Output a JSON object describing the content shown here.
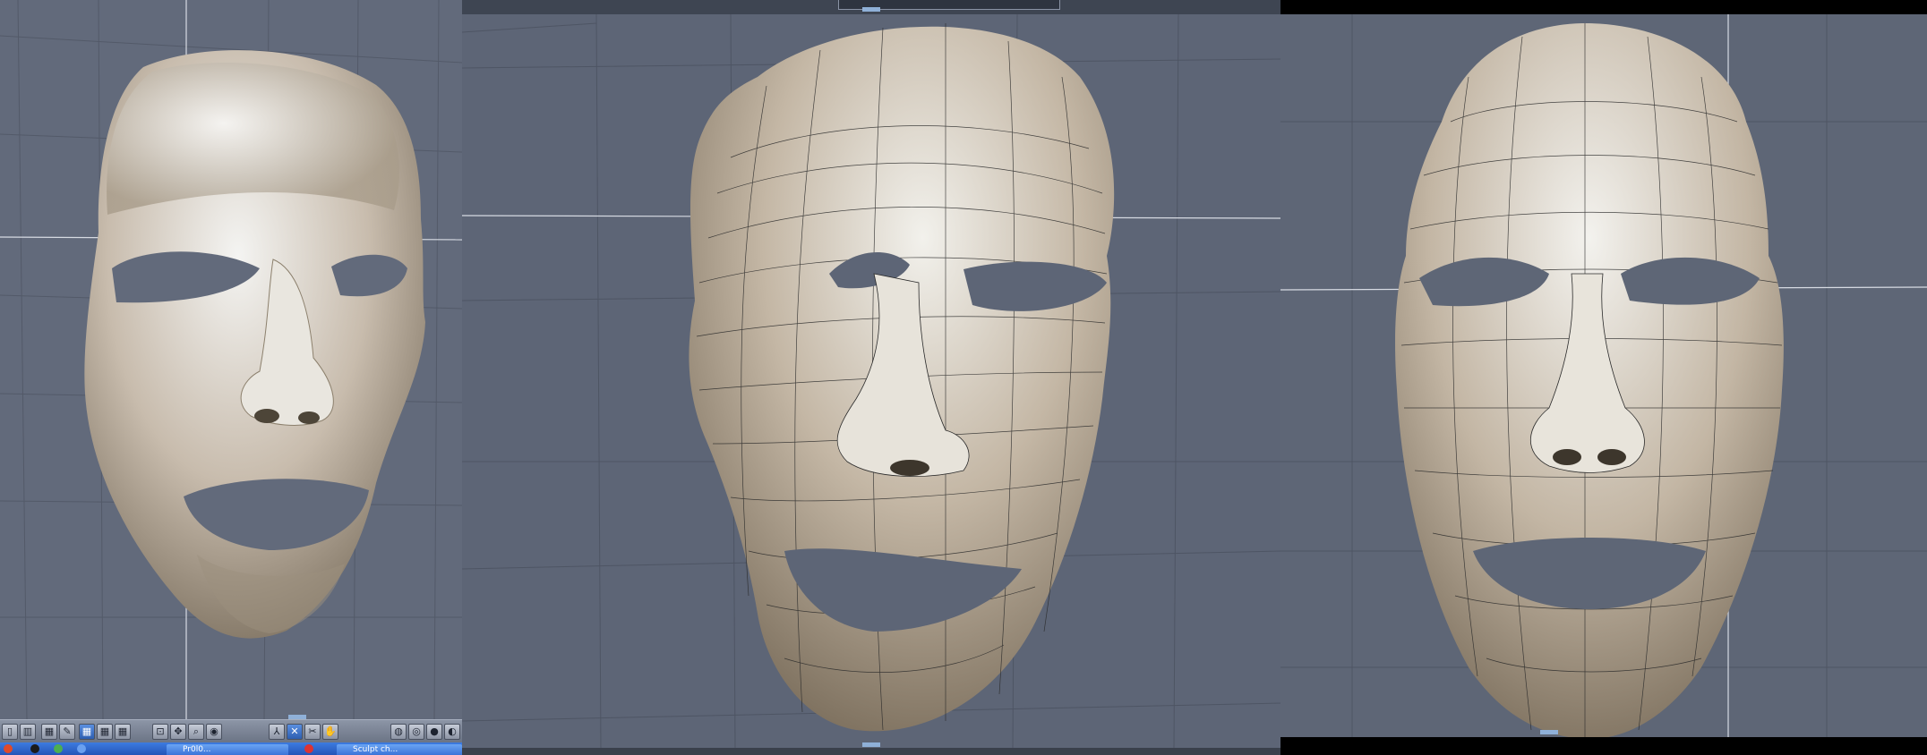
{
  "app": {
    "panels": [
      {
        "name": "viewport-smooth-shaded"
      },
      {
        "name": "viewport-perspective-wireframe"
      },
      {
        "name": "viewport-front-wireframe"
      }
    ]
  },
  "toolbar": {
    "buttons": [
      {
        "icon": "panel-split-icon"
      },
      {
        "icon": "layout-icon"
      },
      {
        "icon": "paint-icon"
      },
      {
        "icon": "grid-quad-icon",
        "active": true
      },
      {
        "icon": "grid-red-icon"
      },
      {
        "icon": "grid-green-icon"
      },
      {
        "icon": "fit-view-icon"
      },
      {
        "icon": "move-view-icon"
      },
      {
        "icon": "zoom-icon"
      },
      {
        "icon": "eye-icon"
      },
      {
        "icon": "axis-icon"
      },
      {
        "icon": "select-tool-icon",
        "active": true
      },
      {
        "icon": "transform-tool-icon"
      },
      {
        "icon": "hand-tool-icon"
      },
      {
        "icon": "wireframe-sphere-icon"
      },
      {
        "icon": "shaded-sphere-icon"
      },
      {
        "icon": "solid-sphere-icon"
      },
      {
        "icon": "textured-sphere-icon"
      }
    ]
  },
  "taskbar": {
    "items": [
      {
        "label": "Pr0l0..."
      },
      {
        "label": "Sculpt ch..."
      }
    ]
  },
  "colors": {
    "viewport_bg": "#626a7b",
    "grid_line": "#4e5564",
    "axis_line": "#d7dbe3",
    "mesh_light": "#efeee9",
    "mesh_mid": "#b6a894",
    "mesh_dark": "#6e6250",
    "wire": "#2a2a2a",
    "accent_blue": "#3b74d8"
  }
}
